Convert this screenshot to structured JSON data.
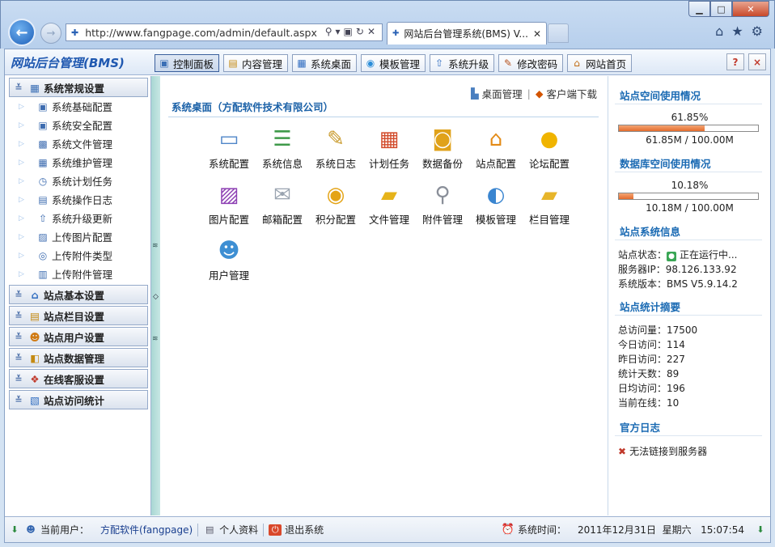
{
  "browser": {
    "url": "http://www.fangpage.com/admin/default.aspx",
    "tab_title": "网站后台管理系统(BMS) V..."
  },
  "app": {
    "logo": "网站后台管理(BMS)",
    "nav": [
      {
        "label": "控制面板",
        "icon": "monitor-icon",
        "active": true
      },
      {
        "label": "内容管理",
        "icon": "document-icon"
      },
      {
        "label": "系统桌面",
        "icon": "desktop-icon"
      },
      {
        "label": "模板管理",
        "icon": "template-icon"
      },
      {
        "label": "系统升级",
        "icon": "upgrade-icon"
      },
      {
        "label": "修改密码",
        "icon": "key-icon"
      },
      {
        "label": "网站首页",
        "icon": "home-icon"
      }
    ],
    "help_label": "?",
    "close_label": "×"
  },
  "sidebar": {
    "sections": [
      {
        "label": "系统常规设置",
        "expanded": true,
        "items": [
          "系统基础配置",
          "系统安全配置",
          "系统文件管理",
          "系统维护管理",
          "系统计划任务",
          "系统操作日志",
          "系统升级更新",
          "上传图片配置",
          "上传附件类型",
          "上传附件管理"
        ]
      },
      {
        "label": "站点基本设置"
      },
      {
        "label": "站点栏目设置"
      },
      {
        "label": "站点用户设置"
      },
      {
        "label": "站点数据管理"
      },
      {
        "label": "在线客服设置"
      },
      {
        "label": "站点访问统计"
      }
    ]
  },
  "main": {
    "links": {
      "desk": "桌面管理",
      "client": "客户端下载"
    },
    "title": "系统桌面（方配软件技术有限公司）",
    "items": [
      "系统配置",
      "系统信息",
      "系统日志",
      "计划任务",
      "数据备份",
      "站点配置",
      "论坛配置",
      "图片配置",
      "邮箱配置",
      "积分配置",
      "文件管理",
      "附件管理",
      "模板管理",
      "栏目管理",
      "用户管理"
    ]
  },
  "right": {
    "space_title": "站点空间使用情况",
    "space_pct_text": "61.85%",
    "space_pct": 61.85,
    "space_detail": "61.85M / 100.00M",
    "db_title": "数据库空间使用情况",
    "db_pct_text": "10.18%",
    "db_pct": 10.18,
    "db_detail": "10.18M / 100.00M",
    "info_title": "站点系统信息",
    "status_label": "站点状态：",
    "status_value": "正在运行中...",
    "ip_label": "服务器IP：",
    "ip_value": "98.126.133.92",
    "version_label": "系统版本：",
    "version_value": "BMS V5.9.14.2",
    "stats_title": "站点统计摘要",
    "stats": [
      "总访问量：17500",
      "今日访问：114",
      "昨日访问：227",
      "统计天数：89",
      "日均访问：196",
      "当前在线：10"
    ],
    "log_title": "官方日志",
    "log_error": "无法链接到服务器"
  },
  "status": {
    "user_label": "当前用户：",
    "user_value": "方配软件(fangpage)",
    "profile": "个人资料",
    "logout": "退出系统",
    "time_label": "系统时间：",
    "time_value": "2011年12月31日  星期六   15:07:54"
  }
}
